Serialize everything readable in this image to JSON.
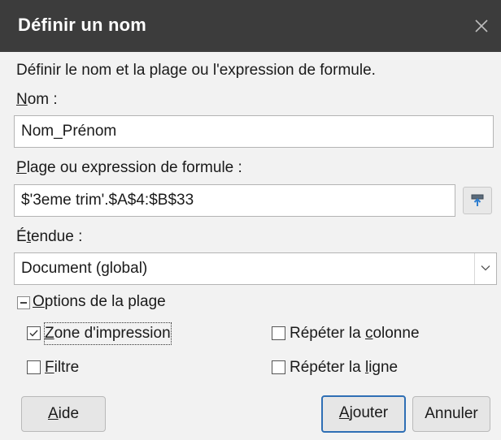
{
  "window": {
    "title": "Définir un nom",
    "close_icon": "close-icon"
  },
  "description": "Définir le nom et la plage ou l'expression de formule.",
  "name_field": {
    "label_prefix": "",
    "label_accel": "N",
    "label_rest": "om :",
    "value": "Nom_Prénom"
  },
  "range_field": {
    "label_prefix": "",
    "label_accel": "P",
    "label_rest": "lage ou expression de formule :",
    "value": "$'3eme trim'.$A$4:$B$33",
    "shrink_icon": "shrink-icon"
  },
  "scope": {
    "label_prefix": "É",
    "label_accel": "t",
    "label_rest": "endue :",
    "selected": "Document (global)"
  },
  "range_options": {
    "label_accel": "O",
    "label_rest": "ptions de la plage",
    "expanded": true,
    "options": [
      {
        "accel": "Z",
        "rest": "one d'impression",
        "prefix": "",
        "checked": true
      },
      {
        "accel": "F",
        "rest": "iltre",
        "prefix": "",
        "checked": false
      },
      {
        "accel": "c",
        "rest": "olonne",
        "prefix": "Répéter la ",
        "checked": false
      },
      {
        "accel": "l",
        "rest": "igne",
        "prefix": "Répéter la ",
        "checked": false
      }
    ]
  },
  "buttons": {
    "help": {
      "accel": "A",
      "rest": "ide"
    },
    "add": {
      "accel": "A",
      "rest": "jouter"
    },
    "cancel": {
      "label": "Annuler"
    }
  },
  "colors": {
    "titlebar": "#3c3c3c",
    "dialog_bg": "#f2f2f2",
    "default_button_border": "#2f6fb5"
  }
}
